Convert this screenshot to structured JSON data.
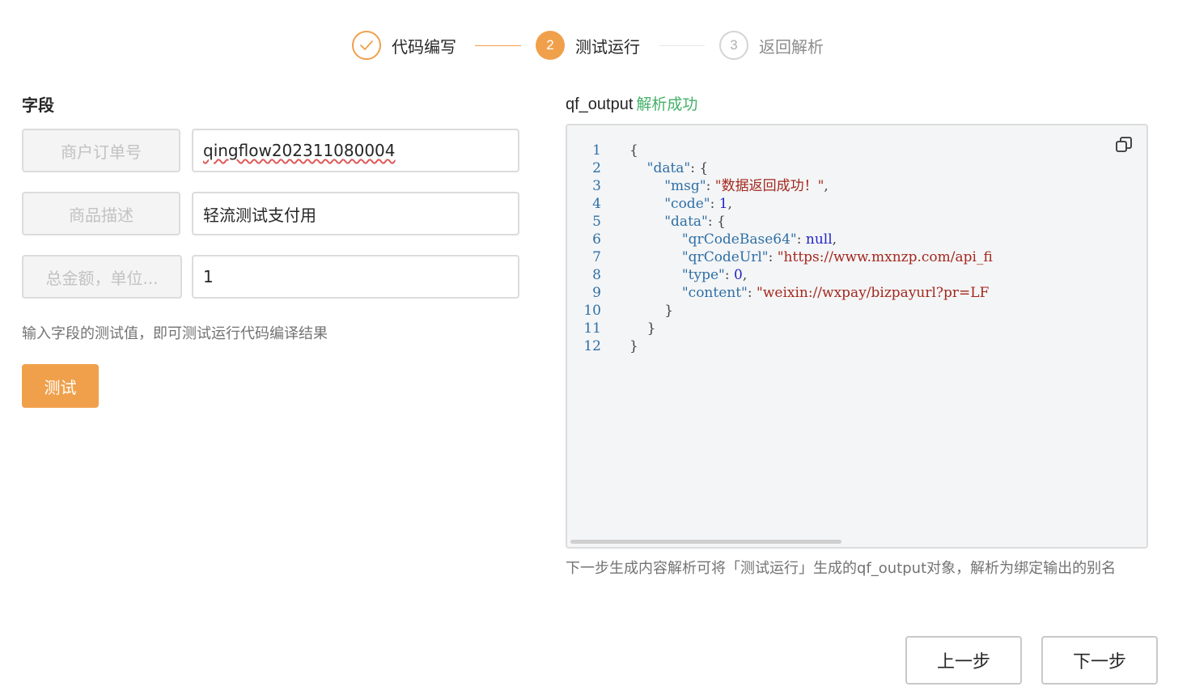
{
  "stepper": {
    "steps": [
      {
        "label": "代码编写",
        "state": "done",
        "index": "1"
      },
      {
        "label": "测试运行",
        "state": "active",
        "index": "2"
      },
      {
        "label": "返回解析",
        "state": "todo",
        "index": "3"
      }
    ],
    "accent": "#f0a04b"
  },
  "fields": {
    "title": "字段",
    "rows": [
      {
        "key": "商户订单号",
        "value": "qingflow202311080004"
      },
      {
        "key": "商品描述",
        "value": "轻流测试支付用"
      },
      {
        "key": "总金额，单位...",
        "value": "1"
      }
    ],
    "hint": "输入字段的测试值，即可测试运行代码编译结果",
    "test_button": "测试"
  },
  "output": {
    "name": "qf_output",
    "status": "解析成功",
    "status_color": "#45b06a",
    "copy_icon": "copy-icon",
    "note": "下一步生成内容解析可将「测试运行」生成的qf_output对象，解析为绑定输出的别名",
    "code_lines": [
      {
        "n": "1",
        "text": "{"
      },
      {
        "n": "2",
        "text": "    \"data\": {"
      },
      {
        "n": "3",
        "text": "        \"msg\": \"数据返回成功！\","
      },
      {
        "n": "4",
        "text": "        \"code\": 1,"
      },
      {
        "n": "5",
        "text": "        \"data\": {"
      },
      {
        "n": "6",
        "text": "            \"qrCodeBase64\": null,"
      },
      {
        "n": "7",
        "text": "            \"qrCodeUrl\": \"https://www.mxnzp.com/api_fi"
      },
      {
        "n": "8",
        "text": "            \"type\": 0,"
      },
      {
        "n": "9",
        "text": "            \"content\": \"weixin://wxpay/bizpayurl?pr=LF"
      },
      {
        "n": "10",
        "text": "        }"
      },
      {
        "n": "11",
        "text": "    }"
      },
      {
        "n": "12",
        "text": "}"
      }
    ]
  },
  "footer": {
    "prev": "上一步",
    "next": "下一步"
  }
}
